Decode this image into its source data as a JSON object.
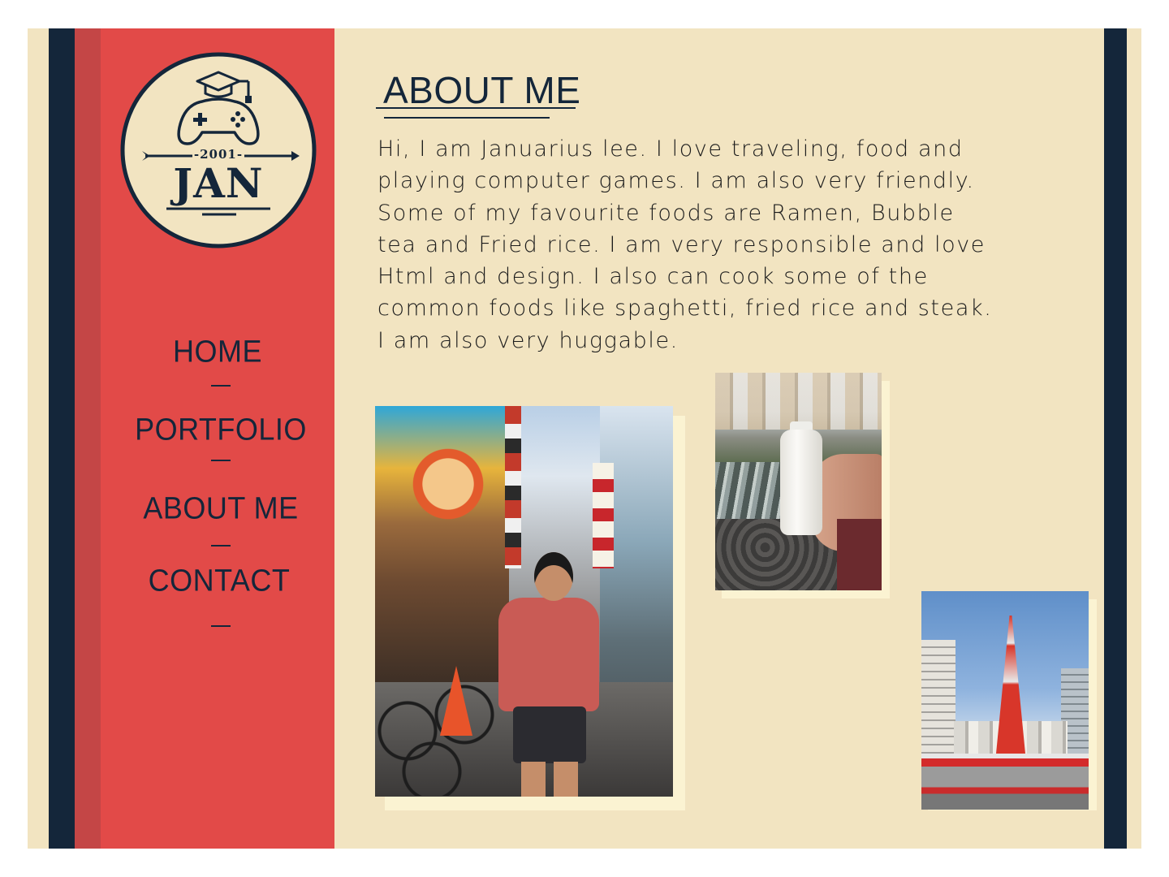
{
  "logo": {
    "year": "-2001-",
    "name": "JAN",
    "icon": "game-controller-graduation-cap-icon"
  },
  "nav": {
    "items": [
      {
        "label": "HOME"
      },
      {
        "label": "PORTFOLIO"
      },
      {
        "label": "ABOUT ME"
      },
      {
        "label": "CONTACT"
      }
    ]
  },
  "main": {
    "heading": "ABOUT ME",
    "paragraph": "Hi, I am Januarius lee. I love traveling, food and playing computer games. I am also very friendly. Some of my favourite foods are Ramen, Bubble tea and Fried rice. I am very responsible and love Html and  design. I also can cook some of the common foods like spaghetti, fried rice and steak. I am also very huggable."
  },
  "colors": {
    "background": "#f2e4c1",
    "sidebar": "#e24a48",
    "navy": "#14263a"
  }
}
